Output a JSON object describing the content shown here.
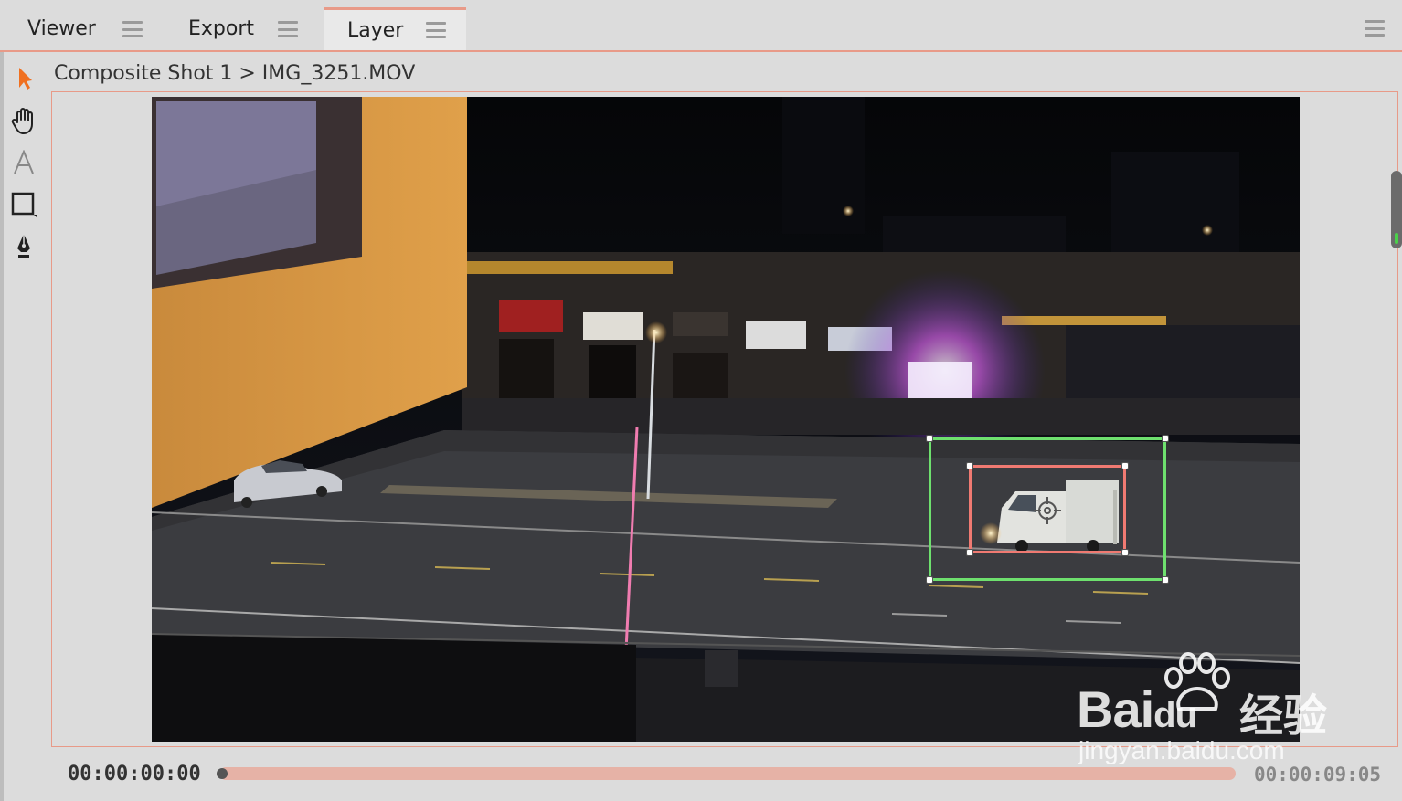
{
  "tabs": [
    {
      "label": "Viewer",
      "active": false
    },
    {
      "label": "Export",
      "active": false
    },
    {
      "label": "Layer",
      "active": true
    }
  ],
  "tools": [
    {
      "name": "select-arrow-icon",
      "active": true
    },
    {
      "name": "hand-pan-icon",
      "active": false
    },
    {
      "name": "text-tool-icon",
      "active": false
    },
    {
      "name": "rectangle-tool-icon",
      "active": false
    },
    {
      "name": "pen-tool-icon",
      "active": false
    }
  ],
  "breadcrumb": "Composite Shot 1 > IMG_3251.MOV",
  "timeline": {
    "current_time": "00:00:00:00",
    "duration": "00:00:09:05",
    "progress": 0
  },
  "watermark": {
    "brand_word": "Bai",
    "brand_du": "du",
    "brand_cn": "经验",
    "url": "jingyan.baidu.com"
  },
  "colors": {
    "accent": "#e89a88",
    "tracking_outer": "#6ee06e",
    "tracking_inner": "#f07a72",
    "select_arrow": "#f07020"
  }
}
